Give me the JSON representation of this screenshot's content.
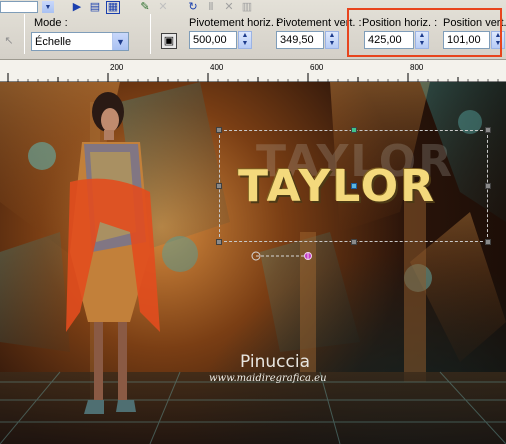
{
  "toolbar": {
    "mode_label": "Mode :",
    "mode_value": "Échelle",
    "pivot_h_label": "Pivotement horiz. :",
    "pivot_h_value": "500,00",
    "pivot_v_label": "Pivotement vert. :",
    "pivot_v_value": "349,50",
    "pos_h_label": "Position horiz. :",
    "pos_h_value": "425,00",
    "pos_v_label": "Position vert. :",
    "pos_v_value": "101,00"
  },
  "ruler": {
    "ticks": [
      "200",
      "400",
      "600",
      "800"
    ]
  },
  "canvas": {
    "title_text": "TAYLOR",
    "signature": "Pinuccia",
    "website": "www.maidiregrafica.eu"
  },
  "colors": {
    "highlight": "#e8441d",
    "title": "#f4d97c",
    "ui_accent": "#7f9db9"
  }
}
